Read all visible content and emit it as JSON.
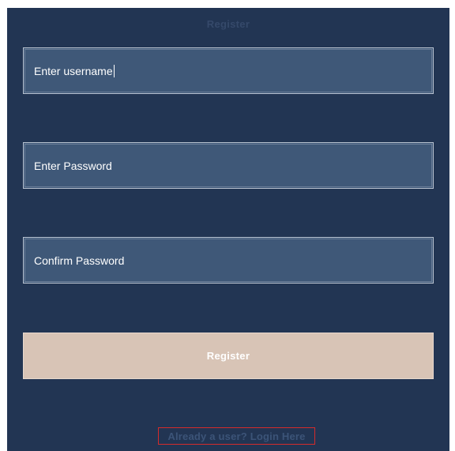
{
  "form": {
    "title": "Register",
    "username": {
      "placeholder": "Enter username",
      "value": ""
    },
    "password": {
      "placeholder": "Enter Password",
      "value": ""
    },
    "confirm_password": {
      "placeholder": "Confirm Password",
      "value": ""
    },
    "submit_label": "Register",
    "login_link": "Already a user? Login Here"
  },
  "colors": {
    "panel_background": "#223553",
    "field_background": "#3f5878",
    "button_background": "#d8c4b6",
    "link_border": "#d42b2b"
  }
}
